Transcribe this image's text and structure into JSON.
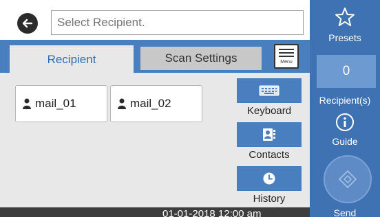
{
  "header": {
    "recipient_placeholder": "Select Recipient."
  },
  "tabs": [
    {
      "label": "Recipient",
      "active": true
    },
    {
      "label": "Scan Settings",
      "active": false
    }
  ],
  "menu": {
    "label": "Menu"
  },
  "recipients": [
    {
      "label": "mail_01"
    },
    {
      "label": "mail_02"
    }
  ],
  "tools": {
    "keyboard": "Keyboard",
    "contacts": "Contacts",
    "history": "History"
  },
  "status": {
    "datetime": "01-01-2018 12:00 am"
  },
  "sidepanel": {
    "presets": "Presets",
    "recipient_count": "0",
    "recipient_label": "Recipient(s)",
    "guide": "Guide",
    "send": "Send"
  },
  "colors": {
    "accent_blue": "#4a7fbf",
    "panel_blue": "#3f72b3",
    "active_tab_text": "#2f6db5"
  }
}
